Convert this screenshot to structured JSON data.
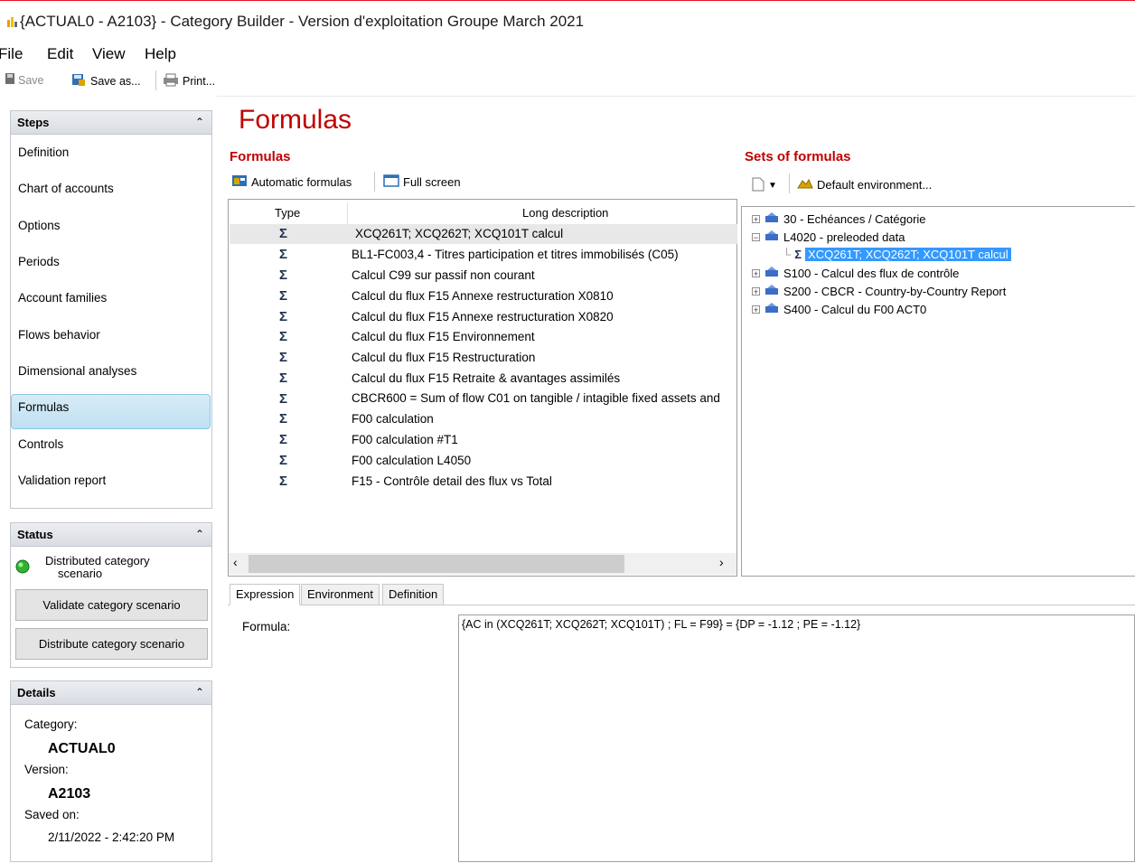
{
  "window": {
    "title": "{ACTUAL0 - A2103} - Category Builder - Version d'exploitation Groupe March 2021"
  },
  "menu": [
    "File",
    "Edit",
    "View",
    "Help"
  ],
  "toolbar": {
    "save": "Save",
    "save_as": "Save as...",
    "print": "Print..."
  },
  "steps": {
    "header": "Steps",
    "items": [
      "Definition",
      "Chart of accounts",
      "Options",
      "Periods",
      "Account families",
      "Flows behavior",
      "Dimensional analyses",
      "Formulas",
      "Controls",
      "Validation report"
    ],
    "active": "Formulas"
  },
  "status": {
    "header": "Status",
    "text_line1": "Distributed category",
    "text_line2": "scenario",
    "indicator_color": "#2db52d",
    "validate_button": "Validate category scenario",
    "distribute_button": "Distribute category scenario"
  },
  "details": {
    "header": "Details",
    "category_label": "Category:",
    "category_value": "ACTUAL0",
    "version_label": "Version:",
    "version_value": "A2103",
    "saved_label": "Saved on:",
    "saved_value": "2/11/2022 - 2:42:20 PM"
  },
  "main": {
    "page_title": "Formulas",
    "formulas_section": "Formulas",
    "automatic_formulas": "Automatic formulas",
    "full_screen": "Full screen",
    "columns": {
      "type": "Type",
      "long_description": "Long description"
    },
    "rows": [
      "XCQ261T; XCQ262T; XCQ101T calcul",
      "BL1-FC003,4 - Titres participation et titres immobilisés (C05)",
      "Calcul C99 sur passif non courant",
      "Calcul du flux F15 Annexe restructuration X0810",
      "Calcul du flux F15 Annexe restructuration X0820",
      "Calcul du flux F15 Environnement",
      "Calcul du flux F15 Restructuration",
      "Calcul du flux F15 Retraite & avantages assimilés",
      "CBCR600 = Sum of flow C01 on tangible / intagible fixed assets and",
      "F00 calculation",
      "F00 calculation #T1",
      "F00 calculation L4050",
      "F15 - Contrôle detail des flux vs Total"
    ],
    "row_icon": "Σ",
    "sets_section": "Sets of formulas",
    "default_environment": "Default environment...",
    "tree": {
      "n1": "30 - Echéances / Catégorie",
      "n2": "L4020 - preleoded data",
      "n2_child": "XCQ261T; XCQ262T; XCQ101T calcul",
      "n3": "S100 - Calcul des flux de contrôle",
      "n4": "S200 - CBCR - Country-by-Country Report",
      "n5": "S400 - Calcul du F00 ACT0"
    },
    "tabs": [
      "Expression",
      "Environment",
      "Definition"
    ],
    "formula_label": "Formula:",
    "formula_value": "{AC in (XCQ261T; XCQ262T; XCQ101T) ; FL = F99} = {DP = -1.12 ; PE = -1.12}"
  }
}
